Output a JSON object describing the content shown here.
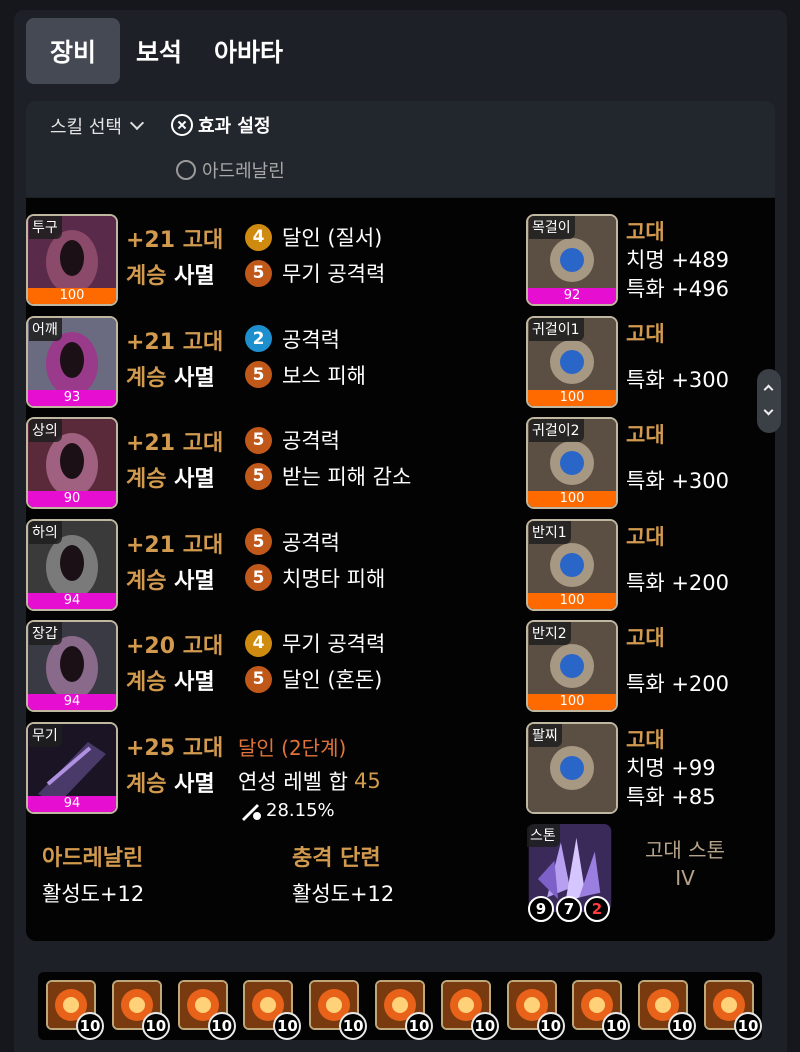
{
  "tabs": [
    {
      "label": "장비",
      "active": true
    },
    {
      "label": "보석",
      "active": false
    },
    {
      "label": "아바타",
      "active": false
    }
  ],
  "settings": {
    "skill_select": "스킬 선택",
    "effect_setting": "효과 설정",
    "adrenaline_option": "아드레날린"
  },
  "equipment": [
    {
      "slot": "투구",
      "quality": "100",
      "quality_color": "orange",
      "enhance": "+21 고대",
      "succession": "계승",
      "set": "사멸",
      "options": [
        {
          "level": "4",
          "color": "yellow",
          "name": "달인 (질서)"
        },
        {
          "level": "5",
          "color": "orange",
          "name": "무기 공격력"
        }
      ]
    },
    {
      "slot": "어깨",
      "quality": "93",
      "quality_color": "pink",
      "enhance": "+21 고대",
      "succession": "계승",
      "set": "사멸",
      "options": [
        {
          "level": "2",
          "color": "blue",
          "name": "공격력"
        },
        {
          "level": "5",
          "color": "orange",
          "name": "보스 피해"
        }
      ]
    },
    {
      "slot": "상의",
      "quality": "90",
      "quality_color": "pink",
      "enhance": "+21 고대",
      "succession": "계승",
      "set": "사멸",
      "options": [
        {
          "level": "5",
          "color": "orange",
          "name": "공격력"
        },
        {
          "level": "5",
          "color": "orange",
          "name": "받는 피해 감소"
        }
      ]
    },
    {
      "slot": "하의",
      "quality": "94",
      "quality_color": "pink",
      "enhance": "+21 고대",
      "succession": "계승",
      "set": "사멸",
      "options": [
        {
          "level": "5",
          "color": "orange",
          "name": "공격력"
        },
        {
          "level": "5",
          "color": "orange",
          "name": "치명타 피해"
        }
      ]
    },
    {
      "slot": "장갑",
      "quality": "94",
      "quality_color": "pink",
      "enhance": "+20 고대",
      "succession": "계승",
      "set": "사멸",
      "options": [
        {
          "level": "4",
          "color": "yellow",
          "name": "무기 공격력"
        },
        {
          "level": "5",
          "color": "orange",
          "name": "달인 (혼돈)"
        }
      ]
    }
  ],
  "weapon": {
    "slot": "무기",
    "quality": "94",
    "enhance": "+25 고대",
    "succession": "계승",
    "set": "사멸",
    "tier": "달인 (2단계)",
    "bond_label": "연성 레벨 합",
    "bond_value": "45",
    "ratio": "28.15%"
  },
  "accessories": [
    {
      "slot": "목걸이",
      "quality": "92",
      "quality_color": "pink",
      "grade": "고대",
      "stats": [
        "치명 +489",
        "특화 +496"
      ]
    },
    {
      "slot": "귀걸이1",
      "quality": "100",
      "quality_color": "orange",
      "grade": "고대",
      "stats": [
        "특화 +300"
      ]
    },
    {
      "slot": "귀걸이2",
      "quality": "100",
      "quality_color": "orange",
      "grade": "고대",
      "stats": [
        "특화 +300"
      ]
    },
    {
      "slot": "반지1",
      "quality": "100",
      "quality_color": "orange",
      "grade": "고대",
      "stats": [
        "특화 +200"
      ]
    },
    {
      "slot": "반지2",
      "quality": "100",
      "quality_color": "orange",
      "grade": "고대",
      "stats": [
        "특화 +200"
      ]
    },
    {
      "slot": "팔찌",
      "grade": "고대",
      "stats": [
        "치명 +99",
        "특화 +85"
      ]
    }
  ],
  "elixirs": [
    {
      "name": "아드레날린",
      "value": "활성도+12"
    },
    {
      "name": "충격 단련",
      "value": "활성도+12"
    }
  ],
  "stone": {
    "slot": "스톤",
    "name_line1": "고대 스톤",
    "name_line2": "IV",
    "engravings": [
      "9",
      "7",
      "2"
    ]
  },
  "gems": [
    "10",
    "10",
    "10",
    "10",
    "10",
    "10",
    "10",
    "10",
    "10",
    "10",
    "10"
  ],
  "colors": {
    "accent_gold": "#d29a4e",
    "quality_pink": "#e60ed0",
    "quality_orange": "#ff6a00",
    "badge_orange": "#c0581a",
    "badge_yellow": "#cf8b10",
    "badge_blue": "#1d8fce"
  }
}
